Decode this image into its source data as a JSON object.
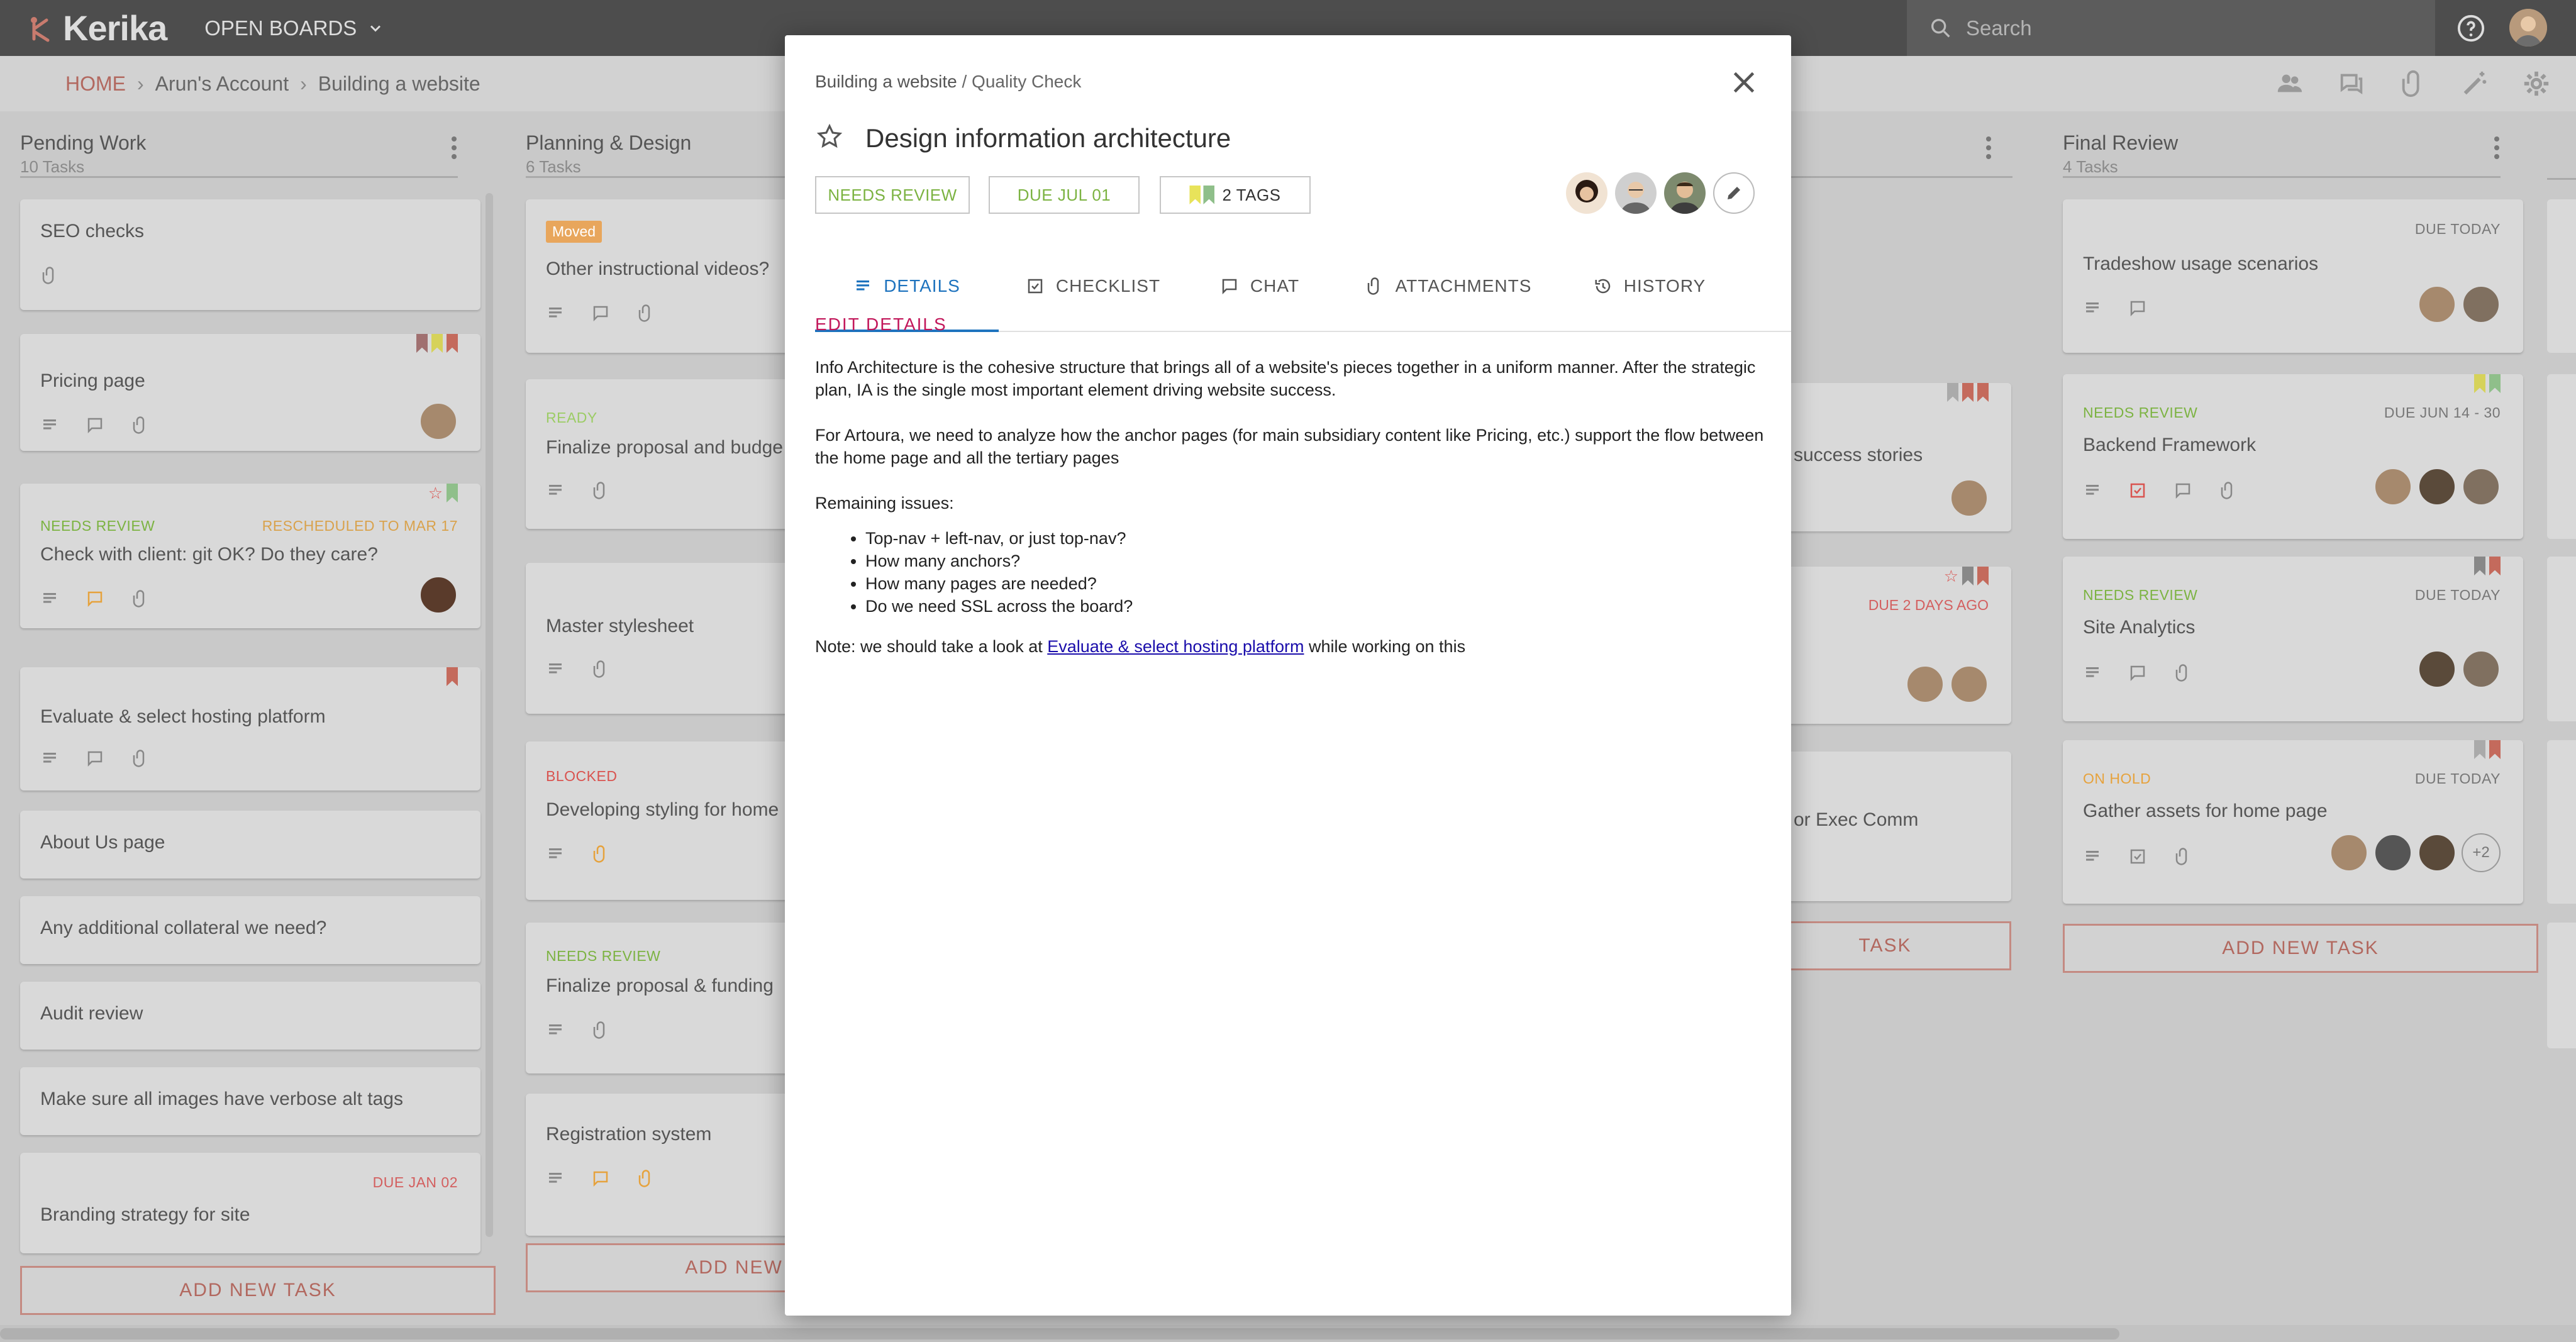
{
  "app": {
    "name": "Kerika",
    "open_boards": "OPEN BOARDS",
    "search_placeholder": "Search"
  },
  "breadcrumb": {
    "home": "HOME",
    "account": "Arun's Account",
    "board": "Building a website"
  },
  "columns": [
    {
      "title": "Pending Work",
      "count": "10 Tasks",
      "add": "ADD NEW TASK",
      "cards": [
        {
          "title": "SEO checks"
        },
        {
          "title": "Pricing page"
        },
        {
          "status": "NEEDS REVIEW",
          "due": "RESCHEDULED TO MAR 17",
          "title": "Check with client: git OK? Do they care?"
        },
        {
          "title": "Evaluate & select hosting platform"
        },
        {
          "title": "About Us page"
        },
        {
          "title": "Any additional collateral we need?"
        },
        {
          "title": "Audit review"
        },
        {
          "title": "Make sure all images have verbose alt tags"
        },
        {
          "due": "DUE JAN 02",
          "title": "Branding strategy for site"
        }
      ]
    },
    {
      "title": "Planning & Design",
      "count": "6 Tasks",
      "add": "ADD NEW TASK",
      "cards": [
        {
          "badge": "Moved",
          "title": "Other instructional videos?"
        },
        {
          "status": "READY",
          "title": "Finalize proposal and budge"
        },
        {
          "title": "Master stylesheet"
        },
        {
          "status": "BLOCKED",
          "title": "Developing styling for home"
        },
        {
          "status": "NEEDS REVIEW",
          "title": "Finalize proposal & funding"
        },
        {
          "title": "Registration system"
        }
      ]
    },
    {
      "title": "",
      "count": "",
      "add": "TASK",
      "cards": [
        {
          "title": "success stories"
        },
        {
          "due": "DUE 2 DAYS AGO",
          "title": ""
        },
        {
          "title": "or Exec Comm"
        }
      ]
    },
    {
      "title": "Final Review",
      "count": "4 Tasks",
      "add": "ADD NEW TASK",
      "cards": [
        {
          "due": "DUE TODAY",
          "title": "Tradeshow usage scenarios"
        },
        {
          "status": "NEEDS REVIEW",
          "due": "DUE JUN 14 - 30",
          "title": "Backend Framework"
        },
        {
          "status": "NEEDS REVIEW",
          "due": "DUE TODAY",
          "title": "Site Analytics"
        },
        {
          "status": "ON HOLD",
          "due": "DUE TODAY",
          "title": "Gather assets for home page",
          "more": "+2"
        }
      ]
    }
  ],
  "modal": {
    "board": "Building a website",
    "sep": " / ",
    "column": "Quality Check",
    "title": "Design information architecture",
    "status": "NEEDS REVIEW",
    "due": "DUE JUL 01",
    "tags": "2 TAGS",
    "tabs": [
      "DETAILS",
      "CHECKLIST",
      "CHAT",
      "ATTACHMENTS",
      "HISTORY"
    ],
    "edit_details": "EDIT DETAILS",
    "para1": "Info Architecture is the cohesive structure that brings all of a website's pieces together in a uniform manner. After the strategic plan, IA is the single most important element driving website success.",
    "para2": "For Artoura, we need to analyze how the anchor pages (for main subsidiary content like Pricing, etc.) support the flow between the home page and all the tertiary pages",
    "remaining": "Remaining issues:",
    "issues": [
      "Top-nav + left-nav, or just top-nav?",
      "How many anchors?",
      "How many pages are needed?",
      "Do we need SSL across the board?"
    ],
    "note_pre": "Note: we should take a look at ",
    "note_link": "Evaluate & select hosting platform",
    "note_post": " while working on this"
  },
  "colors": {
    "accent_red": "#b2685f",
    "tab_blue": "#1e73be",
    "edit_pink": "#c2185b",
    "needs_review_green": "#7cb342",
    "ready_green": "#9ccc65",
    "blocked_red": "#d9534f",
    "on_hold_orange": "#e6a23c",
    "due_red": "#d35f5f"
  }
}
